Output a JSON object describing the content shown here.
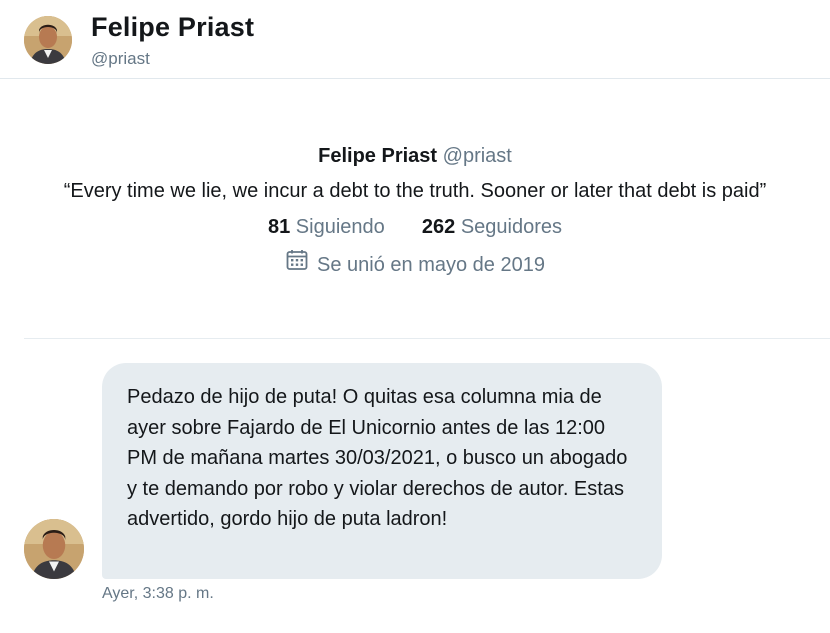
{
  "header": {
    "name": "Felipe Priast",
    "handle": "@priast"
  },
  "profile": {
    "name": "Felipe Priast",
    "handle": "@priast",
    "bio": "“Every time we lie, we incur a debt to the truth. Sooner or later that debt is paid”",
    "following_count": "81",
    "following_label": "Siguiendo",
    "followers_count": "262",
    "followers_label": "Seguidores",
    "joined": "Se unió en mayo de 2019",
    "joined_icon": "calendar-icon"
  },
  "message": {
    "text": "Pedazo de hijo de puta! O quitas esa columna mia de ayer sobre Fajardo de El Unicornio antes de las 12:00 PM de mañana martes 30/03/2021, o busco un abogado y te demando por robo y violar derechos de autor. Estas advertido, gordo hijo de puta ladron!",
    "timestamp": "Ayer, 3:38 p. m."
  },
  "colors": {
    "secondary_text": "#657786",
    "bubble_bg": "#e6ecf0",
    "divider": "#e1e8ed"
  }
}
